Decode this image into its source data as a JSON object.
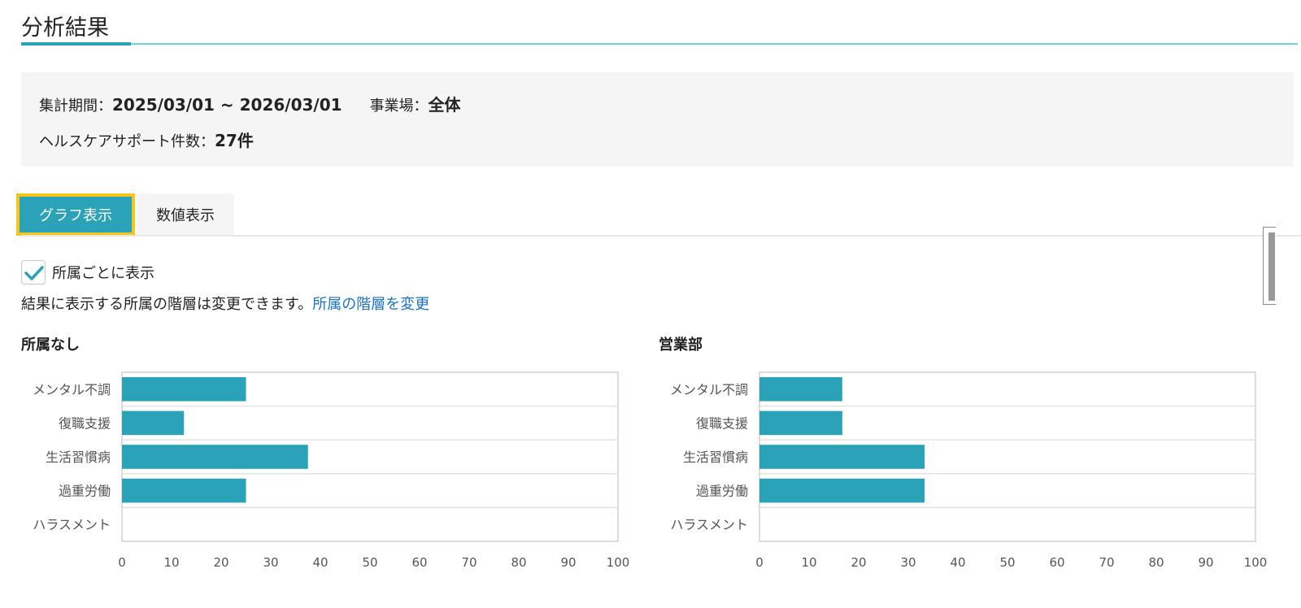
{
  "page": {
    "title": "分析結果"
  },
  "summary": {
    "period_label": "集計期間：",
    "period_value": "2025/03/01 ~ 2026/03/01",
    "site_label": "事業場：",
    "site_value": "全体",
    "count_label": "ヘルスケアサポート件数：",
    "count_value": "27件"
  },
  "tabs": [
    {
      "label": "グラフ表示",
      "active": true
    },
    {
      "label": "数値表示",
      "active": false
    }
  ],
  "options": {
    "group_by_dept_label": "所属ごとに表示",
    "group_by_dept_checked": true,
    "help_text": "結果に表示する所属の階層は変更できます。",
    "help_link": "所属の階層を変更"
  },
  "colors": {
    "bar": "#2aa3b8",
    "accent": "#2aa3b8",
    "tab_highlight": "#f5c518",
    "link": "#1a73c8"
  },
  "chart_data": [
    {
      "type": "bar",
      "orientation": "horizontal",
      "title": "所属なし",
      "categories": [
        "メンタル不調",
        "復職支援",
        "生活習慣病",
        "過重労働",
        "ハラスメント"
      ],
      "values": [
        25,
        12.5,
        37.5,
        25,
        0
      ],
      "xticks": [
        0,
        10,
        20,
        30,
        40,
        50,
        60,
        70,
        80,
        90,
        100
      ],
      "xlim": [
        0,
        100
      ],
      "grid": "horizontal"
    },
    {
      "type": "bar",
      "orientation": "horizontal",
      "title": "営業部",
      "categories": [
        "メンタル不調",
        "復職支援",
        "生活習慣病",
        "過重労働",
        "ハラスメント"
      ],
      "values": [
        16.7,
        16.7,
        33.3,
        33.3,
        0
      ],
      "xticks": [
        0,
        10,
        20,
        30,
        40,
        50,
        60,
        70,
        80,
        90,
        100
      ],
      "xlim": [
        0,
        100
      ],
      "grid": "horizontal"
    }
  ]
}
